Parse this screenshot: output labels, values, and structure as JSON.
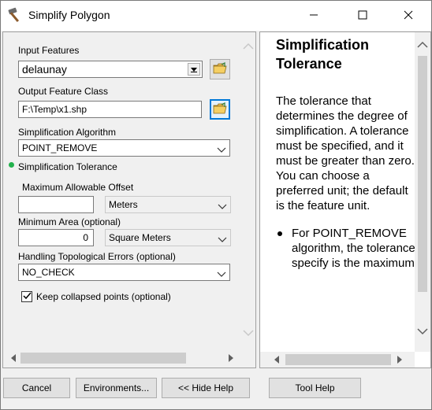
{
  "window": {
    "title": "Simplify Polygon",
    "icons": {
      "app": "hammer-icon",
      "minimize": "minimize-icon",
      "maximize": "maximize-icon",
      "close": "close-icon"
    }
  },
  "form": {
    "input_features": {
      "label": "Input Features",
      "value": "delaunay"
    },
    "output_feature_class": {
      "label": "Output Feature Class",
      "value": "F:\\Temp\\x1.shp"
    },
    "simplification_algorithm": {
      "label": "Simplification Algorithm",
      "value": "POINT_REMOVE"
    },
    "simplification_tolerance": {
      "label": "Simplification Tolerance",
      "max_offset_label": "Maximum Allowable Offset",
      "max_offset_value": "",
      "unit": "Meters"
    },
    "minimum_area": {
      "label": "Minimum Area (optional)",
      "value": "0",
      "unit": "Square Meters"
    },
    "handling_errors": {
      "label": "Handling Topological Errors (optional)",
      "value": "NO_CHECK"
    },
    "keep_collapsed": {
      "label": "Keep collapsed points (optional)",
      "checked": true
    }
  },
  "help": {
    "title_line1": "Simplification",
    "title_line2": "Tolerance",
    "body": "The tolerance that determines the degree of simplification. A tolerance must be specified, and it must be greater than zero. You can choose a preferred unit; the default is the feature unit.",
    "bullet": "For POINT_REMOVE algorithm, the tolerance you specify is the maximum"
  },
  "buttons": {
    "cancel": "Cancel",
    "environments": "Environments...",
    "hide_help": "<< Hide Help",
    "tool_help": "Tool Help"
  },
  "colors": {
    "required_indicator": "#22b14c",
    "focus_border": "#0078d7"
  }
}
